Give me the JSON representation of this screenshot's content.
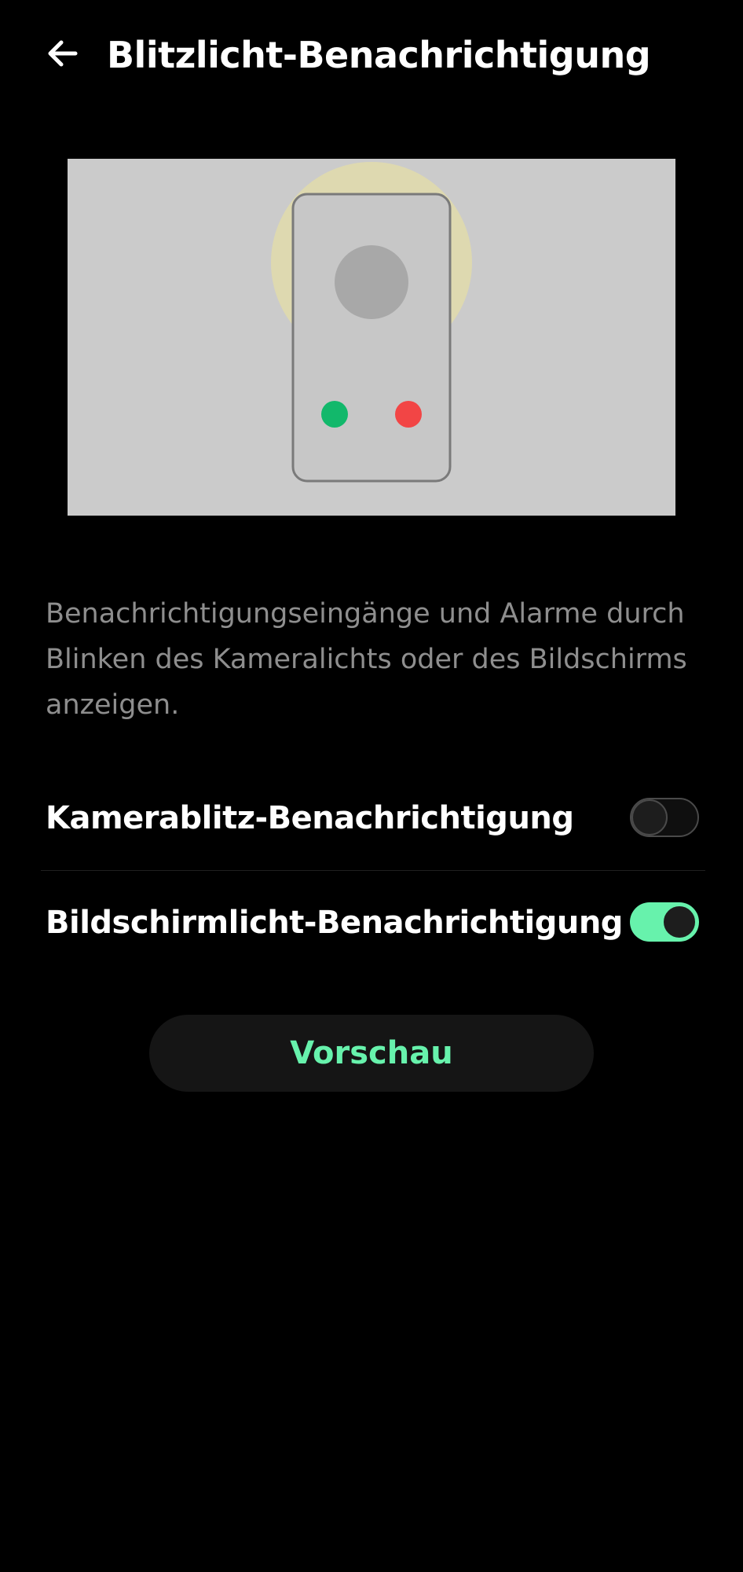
{
  "header": {
    "back_icon": "arrow-left-icon",
    "title": "Blitzlicht-Benachrichtigung"
  },
  "illustration": {
    "background_color": "#cbcbcb",
    "glow_color": "#ded9b0",
    "green_dot_color": "#12b86b",
    "red_dot_color": "#f24545"
  },
  "description": "Benachrichtigungseingänge und Alarme durch Blinken des Kameralichts oder des Bildschirms anzeigen.",
  "settings": [
    {
      "label": "Kamerablitz-Benachrichtigung",
      "enabled": false
    },
    {
      "label": "Bildschirmlicht-Benachrichtigung",
      "enabled": true
    }
  ],
  "preview_button": {
    "label": "Vorschau"
  },
  "colors": {
    "accent": "#67f2ac",
    "background": "#000000",
    "secondary_text": "#8e8e8e"
  }
}
